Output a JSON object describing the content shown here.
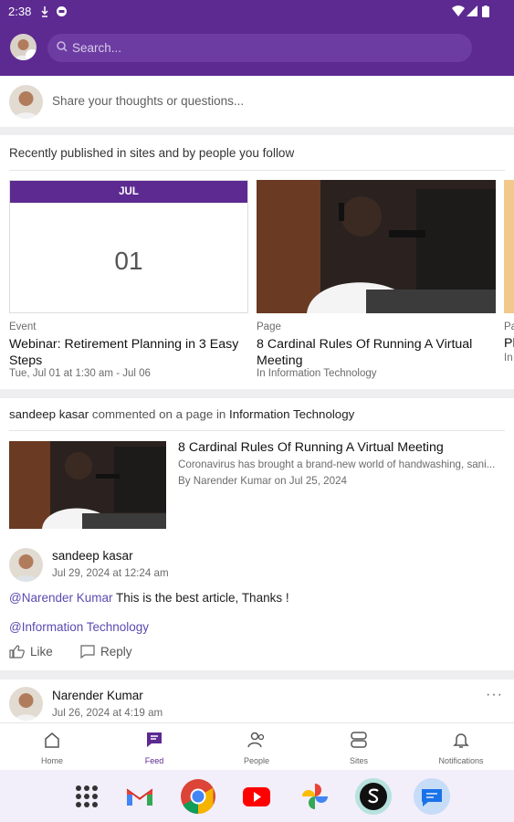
{
  "status_bar": {
    "time": "2:38"
  },
  "header": {
    "search_placeholder": "Search..."
  },
  "compose": {
    "placeholder": "Share your thoughts or questions..."
  },
  "recent": {
    "heading": "Recently published in sites and by people you follow",
    "items": [
      {
        "type": "Event",
        "month": "JUL",
        "day": "01",
        "title": "Webinar: Retirement Planning in 3 Easy Steps",
        "meta": "Tue, Jul 01 at 1:30 am - Jul 06"
      },
      {
        "type": "Page",
        "title": "8 Cardinal Rules Of Running A Virtual Meeting",
        "meta": "In Information Technology"
      },
      {
        "type": "Pa",
        "title": "Pl",
        "meta": "In"
      }
    ]
  },
  "activity": {
    "actor": "sandeep kasar",
    "action": " commented on a page in ",
    "site": "Information Technology",
    "article": {
      "title": "8 Cardinal Rules Of Running A Virtual Meeting",
      "description": "Coronavirus has brought a brand-new world of handwashing, sani...",
      "byline": "By Narender Kumar on Jul 25, 2024"
    },
    "comment": {
      "author": "sandeep kasar",
      "time": "Jul 29, 2024 at 12:24 am",
      "mention": "@Narender Kumar",
      "text": " This is the best article, Thanks !",
      "site_tag": "@Information Technology"
    },
    "like_label": "Like",
    "reply_label": "Reply"
  },
  "post": {
    "author": "Narender Kumar",
    "time": "Jul 26, 2024 at 4:19 am",
    "more": "···"
  },
  "bottom_nav": [
    {
      "label": "Home",
      "icon": "home-icon"
    },
    {
      "label": "Feed",
      "icon": "feed-icon",
      "active": true
    },
    {
      "label": "People",
      "icon": "people-icon"
    },
    {
      "label": "Sites",
      "icon": "sites-icon"
    },
    {
      "label": "Notifications",
      "icon": "bell-icon"
    }
  ],
  "dock": [
    "app-drawer-icon",
    "gmail-icon",
    "chrome-icon",
    "youtube-icon",
    "photos-icon",
    "threads-icon",
    "messages-icon"
  ],
  "colors": {
    "brand": "#5c2a91",
    "mention": "#5a4bb0"
  }
}
